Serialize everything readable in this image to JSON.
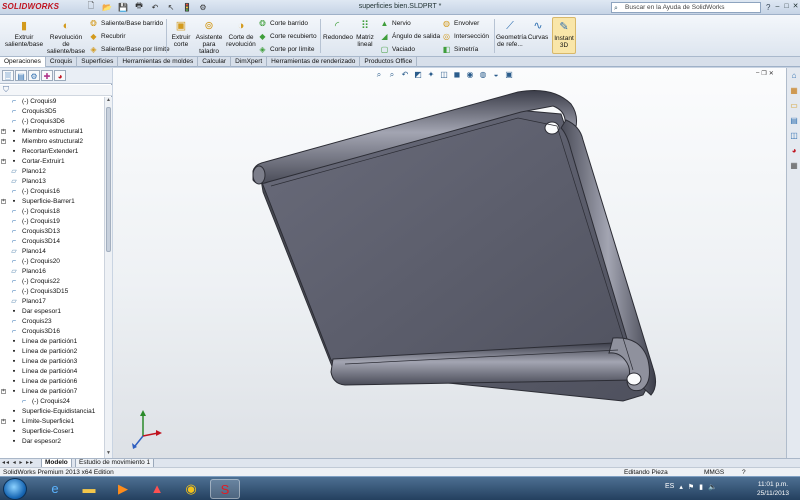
{
  "app": {
    "logo_text": "SOLIDWORKS",
    "document_title": "superficies bien.SLDPRT *",
    "help_search_placeholder": "Buscar en la Ayuda de SolidWorks"
  },
  "ribbon": {
    "extrude_boss": "Extruir saliente/base",
    "revolve_boss": "Revolución de saliente/base",
    "swept_boss": "Saliente/Base barrido",
    "wrap_cut": "Recubrir",
    "boundary_boss": "Saliente/Base por límite",
    "extrude_cut": "Extruir corte",
    "hole_wizard": "Asistente para taladro",
    "revolve_cut": "Corte de revolución",
    "swept_cut": "Corte barrido",
    "lofted_cut": "Corte recubierto",
    "boundary_cut": "Corte por límite",
    "fillet": "Redondeo",
    "linear_pattern": "Matriz lineal",
    "rib": "Nervio",
    "draft": "Ángulo de salida",
    "shell": "Vaciado",
    "wrap": "Envolver",
    "intersect": "Intersección",
    "mirror": "Simetría",
    "reference_geometry": "Geometría de refe...",
    "curves": "Curvas",
    "instant3d": "Instant 3D"
  },
  "command_tabs": [
    "Operaciones",
    "Croquis",
    "Superficies",
    "Herramientas de moldes",
    "Calcular",
    "DimXpert",
    "Herramientas de renderizado",
    "Productos Office"
  ],
  "feature_tree": [
    {
      "label": "(-) Croquis9",
      "icon": "sketch",
      "expand": false
    },
    {
      "label": "Croquis3D5",
      "icon": "sketch",
      "expand": false
    },
    {
      "label": "(-) Croquis3D6",
      "icon": "sketch",
      "expand": false
    },
    {
      "label": "Miembro estructural1",
      "icon": "feature",
      "expand": true
    },
    {
      "label": "Miembro estructural2",
      "icon": "feature",
      "expand": true
    },
    {
      "label": "Recortar/Extender1",
      "icon": "feature",
      "expand": false
    },
    {
      "label": "Cortar-Extruir1",
      "icon": "feature",
      "expand": true
    },
    {
      "label": "Plano12",
      "icon": "plane",
      "expand": false
    },
    {
      "label": "Plano13",
      "icon": "plane",
      "expand": false
    },
    {
      "label": "(-) Croquis16",
      "icon": "sketch",
      "expand": false
    },
    {
      "label": "Superficie-Barrer1",
      "icon": "feature",
      "expand": true
    },
    {
      "label": "(-) Croquis18",
      "icon": "sketch",
      "expand": false
    },
    {
      "label": "(-) Croquis19",
      "icon": "sketch",
      "expand": false
    },
    {
      "label": "Croquis3D13",
      "icon": "sketch",
      "expand": false
    },
    {
      "label": "Croquis3D14",
      "icon": "sketch",
      "expand": false
    },
    {
      "label": "Plano14",
      "icon": "plane",
      "expand": false
    },
    {
      "label": "(-) Croquis20",
      "icon": "sketch",
      "expand": false
    },
    {
      "label": "Plano16",
      "icon": "plane",
      "expand": false
    },
    {
      "label": "(-) Croquis22",
      "icon": "sketch",
      "expand": false
    },
    {
      "label": "(-) Croquis3D15",
      "icon": "sketch",
      "expand": false
    },
    {
      "label": "Plano17",
      "icon": "plane",
      "expand": false
    },
    {
      "label": "Dar espesor1",
      "icon": "feature",
      "expand": false
    },
    {
      "label": "Croquis23",
      "icon": "sketch",
      "expand": false
    },
    {
      "label": "Croquis3D16",
      "icon": "sketch",
      "expand": false
    },
    {
      "label": "Línea de partición1",
      "icon": "feature",
      "expand": false
    },
    {
      "label": "Línea de partición2",
      "icon": "feature",
      "expand": false
    },
    {
      "label": "Línea de partición3",
      "icon": "feature",
      "expand": false
    },
    {
      "label": "Línea de partición4",
      "icon": "feature",
      "expand": false
    },
    {
      "label": "Línea de partición6",
      "icon": "feature",
      "expand": false
    },
    {
      "label": "Línea de partición7",
      "icon": "feature",
      "expand": true
    },
    {
      "label": "(-) Croquis24",
      "icon": "sketch",
      "expand": false,
      "indent": true
    },
    {
      "label": "Superficie-Equidistancia1",
      "icon": "feature",
      "expand": false
    },
    {
      "label": "Límite-Superficie1",
      "icon": "feature",
      "expand": true
    },
    {
      "label": "Superficie-Coser1",
      "icon": "feature",
      "expand": false
    },
    {
      "label": "Dar espesor2",
      "icon": "feature",
      "expand": false
    }
  ],
  "bottom_tabs": {
    "model": "Modelo",
    "motion_study": "Estudio de movimiento 1"
  },
  "status": {
    "edition": "SolidWorks Premium 2013 x64 Edition",
    "mode": "Editando Pieza",
    "units": "MMGS",
    "help": "?"
  },
  "taskbar": {
    "language": "ES",
    "time": "11:01 p.m.",
    "date": "25/11/2013"
  },
  "colors": {
    "part_body": "#5d5f6d",
    "part_shadow": "#3e404c",
    "part_highlight": "#a9abb8",
    "brand_red": "#c0131f"
  }
}
